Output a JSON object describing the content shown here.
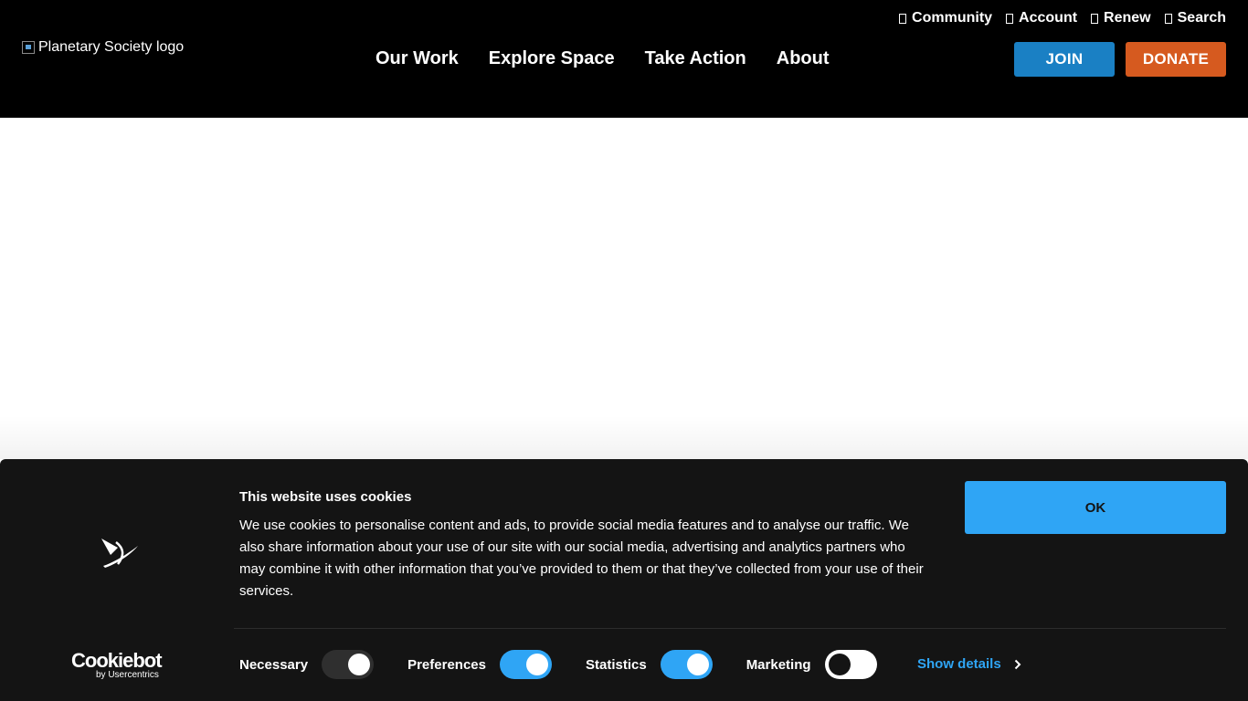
{
  "header": {
    "logo_alt": "Planetary Society logo",
    "utility_nav": [
      {
        "label": "Community",
        "icon": "box-icon"
      },
      {
        "label": "Account",
        "icon": "box-icon"
      },
      {
        "label": "Renew",
        "icon": "box-icon"
      },
      {
        "label": "Search",
        "icon": "box-icon"
      }
    ],
    "main_nav": [
      "Our Work",
      "Explore Space",
      "Take Action",
      "About"
    ],
    "join_label": "JOIN",
    "donate_label": "DONATE"
  },
  "cookie_banner": {
    "title": "This website uses cookies",
    "body": "We use cookies to personalise content and ads, to provide social media features and to analyse our traffic. We also share information about your use of our site with our social media, advertising and analytics partners who may combine it with other information that you’ve provided to them or that they’ve collected from your use of their services.",
    "ok_label": "OK",
    "toggles": [
      {
        "label": "Necessary",
        "state": "on-disabled"
      },
      {
        "label": "Preferences",
        "state": "on"
      },
      {
        "label": "Statistics",
        "state": "on"
      },
      {
        "label": "Marketing",
        "state": "off"
      }
    ],
    "show_details_label": "Show details",
    "brand": {
      "word": "Cookiebot",
      "sub": "by Usercentrics"
    }
  },
  "colors": {
    "header_bg": "#000000",
    "join": "#1a80c4",
    "donate": "#d65a1f",
    "banner_bg": "#141414",
    "accent": "#2fa5f5"
  }
}
